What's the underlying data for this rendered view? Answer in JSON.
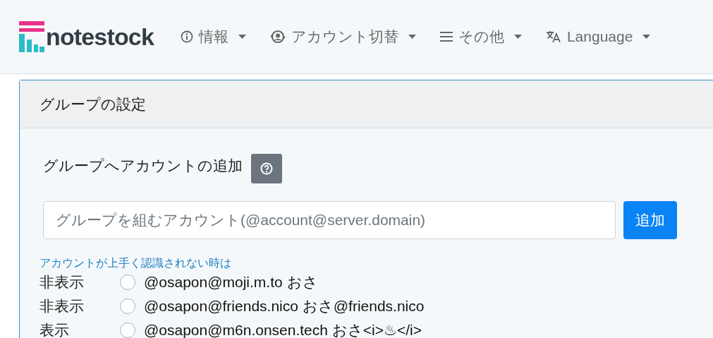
{
  "navbar": {
    "brand": "notestock",
    "menus": [
      {
        "kind": "info",
        "label": "情報"
      },
      {
        "kind": "account",
        "label": "アカウント切替"
      },
      {
        "kind": "menu",
        "label": "その他"
      },
      {
        "kind": "language",
        "label": "Language"
      }
    ]
  },
  "card": {
    "title": "グループの設定",
    "section_title": "グループへアカウントの追加",
    "account_field": {
      "placeholder": "グループを組むアカウント(@account@server.domain)"
    },
    "add_button": "追加",
    "help_link": "アカウントが上手く認識されない時は",
    "accounts": [
      {
        "visibility": "非表示",
        "checked": false,
        "account": "@osapon@moji.m.to おさ"
      },
      {
        "visibility": "非表示",
        "checked": false,
        "account": "@osapon@friends.nico おさ@friends.nico"
      },
      {
        "visibility": "表示",
        "checked": false,
        "account": "@osapon@m6n.onsen.tech おさ<i>♨</i>"
      }
    ]
  }
}
